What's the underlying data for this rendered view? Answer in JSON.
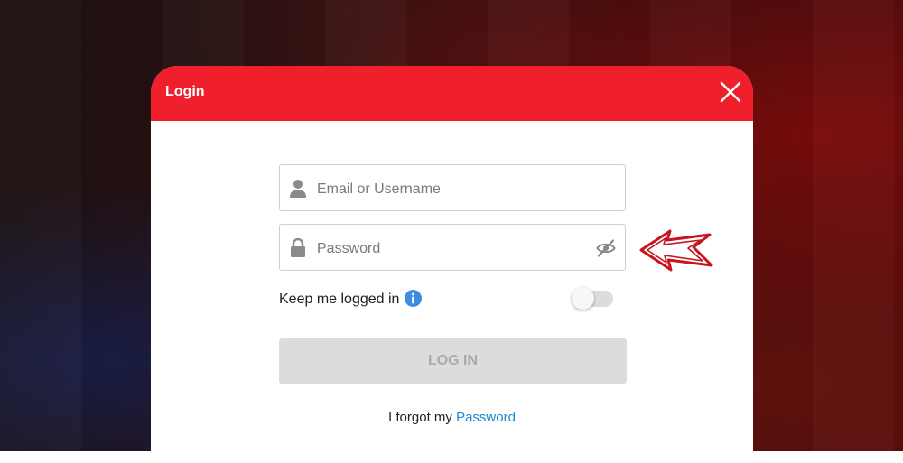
{
  "modal": {
    "title": "Login",
    "close_icon": "close-icon"
  },
  "form": {
    "email_placeholder": "Email or Username",
    "password_placeholder": "Password",
    "remember_label": "Keep me logged in",
    "remember_on": false,
    "login_label": "LOG IN",
    "forgot_text": "I forgot my",
    "forgot_link": "Password"
  },
  "icons": {
    "user": "user-icon",
    "lock": "lock-icon",
    "eye": "eye-slash-icon",
    "info": "info-icon",
    "arrow": "arrow-left-icon"
  },
  "colors": {
    "header": "#ef1f2b",
    "link": "#1a8ad3",
    "info": "#3b8ee0",
    "arrow": "#c8141e",
    "button_disabled": "#dcdcdc"
  }
}
